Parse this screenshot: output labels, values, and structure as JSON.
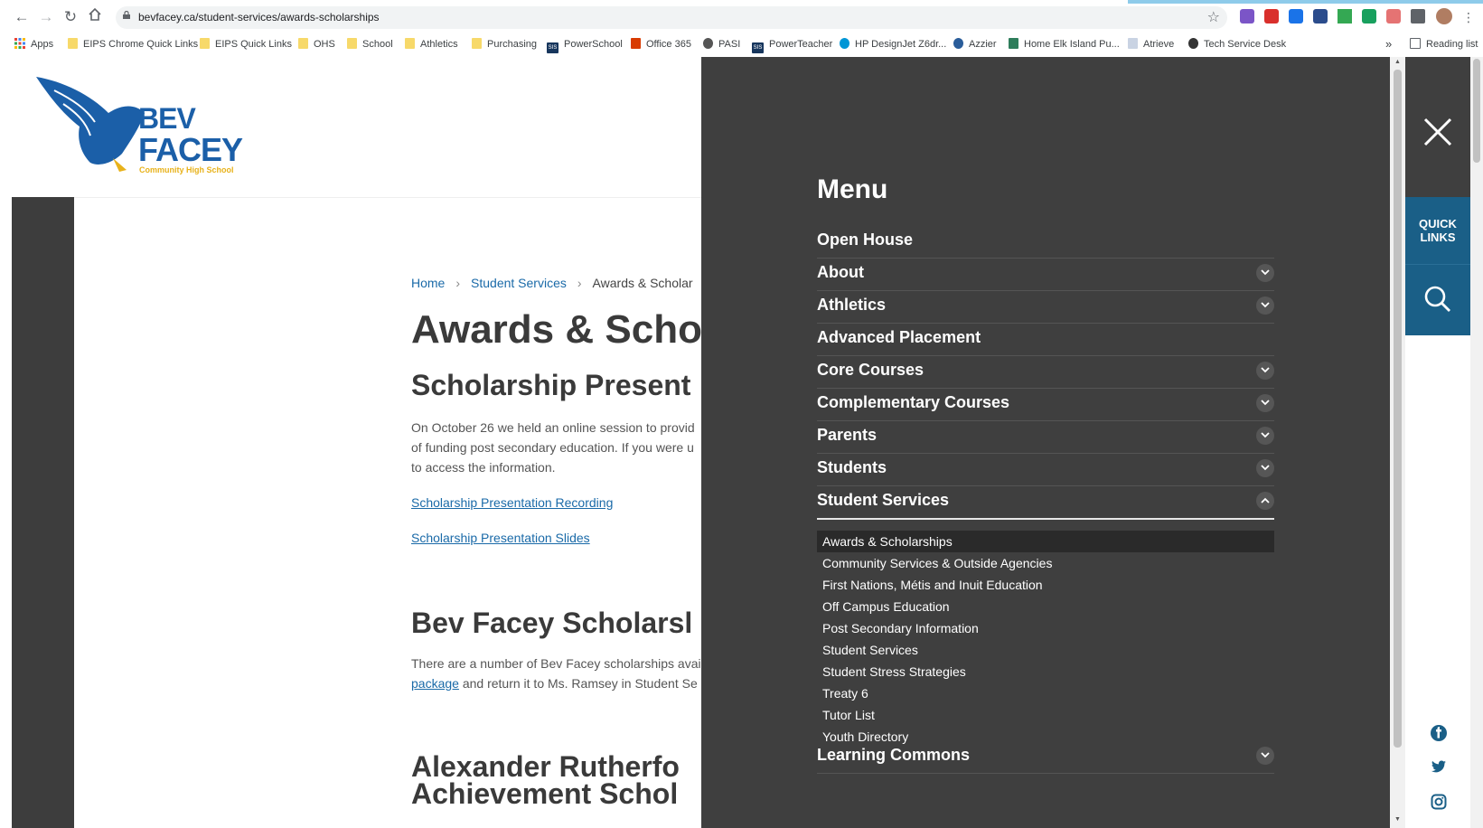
{
  "browser": {
    "url": "bevfacey.ca/student-services/awards-scholarships",
    "bookmarks": [
      "Apps",
      "EIPS Chrome Quick Links",
      "EIPS Quick Links",
      "OHS",
      "School",
      "Athletics",
      "Purchasing",
      "PowerSchool",
      "Office 365",
      "PASI",
      "PowerTeacher",
      "HP DesignJet Z6dr...",
      "Azzier",
      "Home Elk Island Pu...",
      "Atrieve",
      "Tech Service Desk"
    ],
    "overflow": "»",
    "reading_list": "Reading list",
    "sis_badge": "SIS"
  },
  "logo": {
    "line1": "BEV",
    "line2": "FACEY",
    "line3": "Community High School"
  },
  "breadcrumb": {
    "home": "Home",
    "parent": "Student Services",
    "current": "Awards & Scholar"
  },
  "page": {
    "title": "Awards & Scho",
    "section1_heading": "Scholarship Present",
    "section1_line1": "On October 26 we held an online session to provid",
    "section1_line2": "of funding post secondary education. If you were u",
    "section1_line3": "to access the information.",
    "link_recording": "Scholarship Presentation Recording",
    "link_slides": "Scholarship Presentation Slides",
    "section2_heading": "Bev Facey Scholarsl",
    "section2_line1": "There are a number of Bev Facey scholarships avai",
    "section2_link": "package",
    "section2_line2_rest": " and return it to Ms. Ramsey in Student Se",
    "section3_heading_line1": "Alexander Rutherfo",
    "section3_heading_line2": "Achievement Schol"
  },
  "menu": {
    "title": "Menu",
    "items": [
      {
        "label": "Open House",
        "expandable": false
      },
      {
        "label": "About",
        "expandable": true
      },
      {
        "label": "Athletics",
        "expandable": true
      },
      {
        "label": "Advanced Placement",
        "expandable": false
      },
      {
        "label": "Core Courses",
        "expandable": true
      },
      {
        "label": "Complementary Courses",
        "expandable": true
      },
      {
        "label": "Parents",
        "expandable": true
      },
      {
        "label": "Students",
        "expandable": true
      },
      {
        "label": "Student Services",
        "expandable": true,
        "open": true
      },
      {
        "label": "Learning Commons",
        "expandable": true
      }
    ],
    "student_services_sub": [
      "Awards & Scholarships",
      "Community Services & Outside Agencies",
      "First Nations, Métis and Inuit Education",
      "Off Campus Education",
      "Post Secondary Information",
      "Student Services",
      "Student Stress Strategies",
      "Treaty 6",
      "Tutor List",
      "Youth Directory"
    ],
    "active_sub": "Awards & Scholarships"
  },
  "rail": {
    "quick_links_line1": "QUICK",
    "quick_links_line2": "LINKS"
  },
  "colors": {
    "menu_bg": "#3f3f3f",
    "rail_blue": "#1a5f87",
    "link": "#1a6aa8",
    "logo_blue": "#1b5fa8",
    "logo_gold": "#e8b21b"
  }
}
